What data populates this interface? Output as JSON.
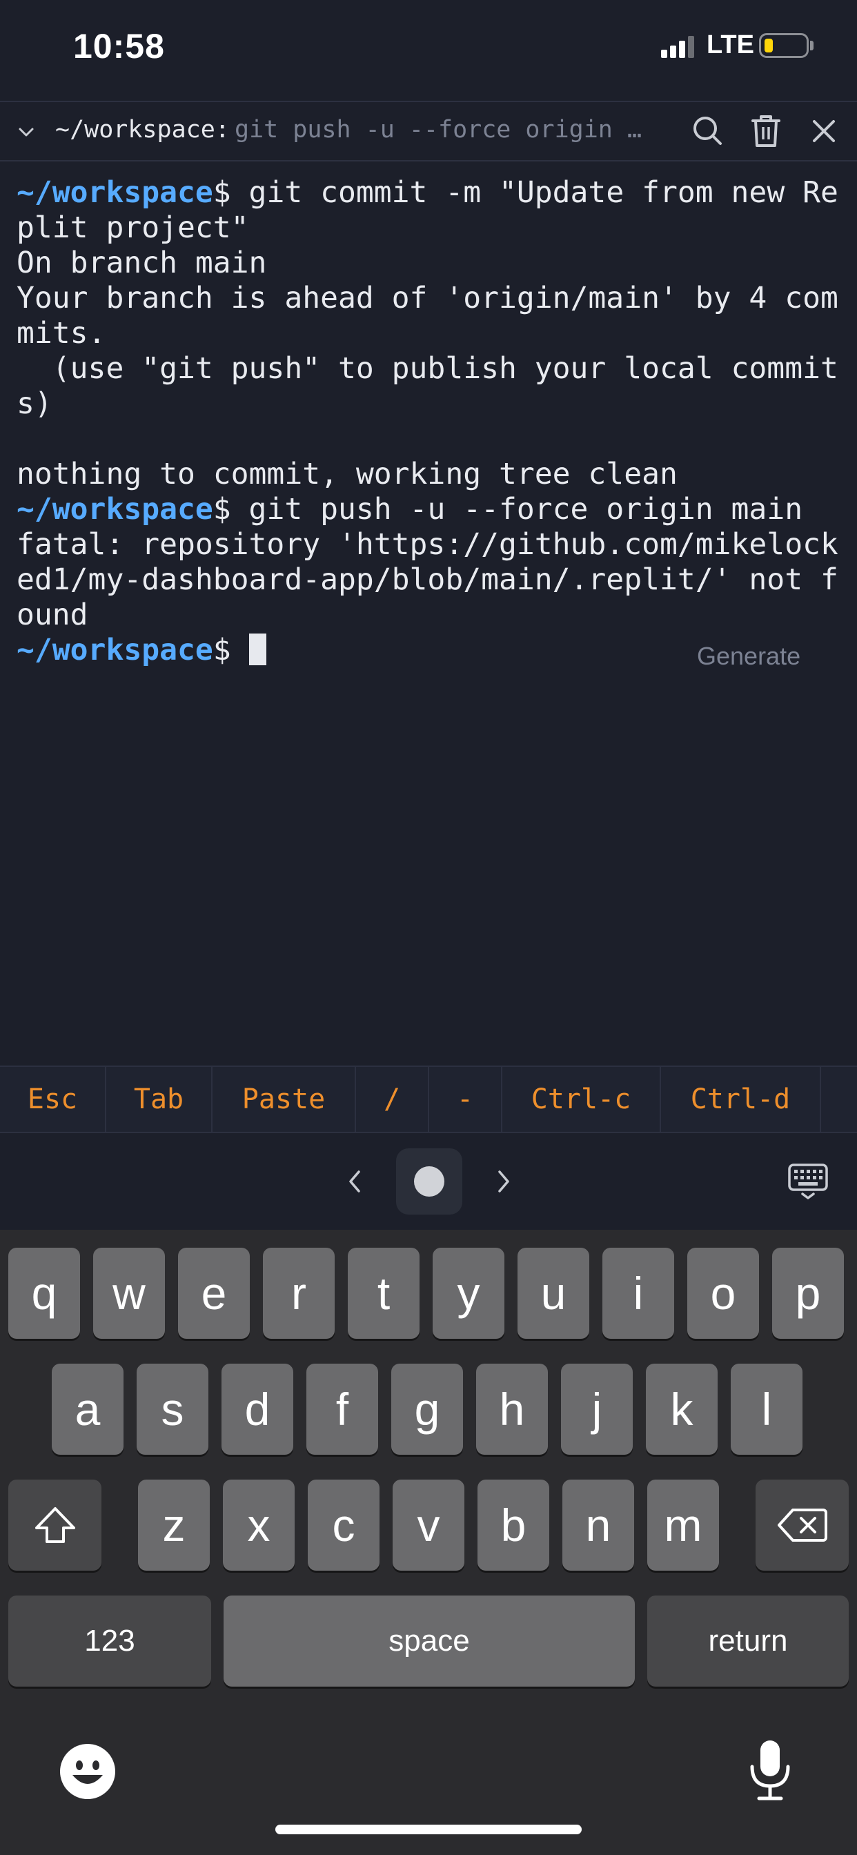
{
  "status_bar": {
    "time": "10:58",
    "network": "LTE",
    "battery_level": 0.2,
    "colors": {
      "battery": "#ffd60a"
    }
  },
  "terminal_tab": {
    "title": "~/workspace:",
    "command": "git push -u --force origin …",
    "icons": [
      "chevron-down-icon",
      "search-icon",
      "trash-icon",
      "close-icon"
    ]
  },
  "terminal": {
    "lines": [
      {
        "prompt": "~/workspace",
        "text": "$ git commit -m \"Update from new Re"
      },
      {
        "prompt": "",
        "text": "plit project\""
      },
      {
        "prompt": "",
        "text": "On branch main"
      },
      {
        "prompt": "",
        "text": "Your branch is ahead of 'origin/main' by 4 com"
      },
      {
        "prompt": "",
        "text": "mits."
      },
      {
        "prompt": "",
        "text": "  (use \"git push\" to publish your local commit"
      },
      {
        "prompt": "",
        "text": "s)"
      },
      {
        "prompt": "",
        "text": ""
      },
      {
        "prompt": "",
        "text": "nothing to commit, working tree clean"
      },
      {
        "prompt": "~/workspace",
        "text": "$ git push -u --force origin main"
      },
      {
        "prompt": "",
        "text": "fatal: repository 'https://github.com/mikelock"
      },
      {
        "prompt": "",
        "text": "ed1/my-dashboard-app/blob/main/.replit/' not f"
      },
      {
        "prompt": "",
        "text": "ound"
      },
      {
        "prompt": "~/workspace",
        "text": "$ ",
        "cursor": true
      }
    ],
    "generate_hint": "Generate",
    "colors": {
      "prompt": "#57abff",
      "text": "#e9ebf0"
    }
  },
  "extra_keys": {
    "keys": [
      "Esc",
      "Tab",
      "Paste",
      "/",
      "-",
      "Ctrl-c",
      "Ctrl-d"
    ],
    "color": "#ee8f2c"
  },
  "keyboard": {
    "row1": [
      "q",
      "w",
      "e",
      "r",
      "t",
      "y",
      "u",
      "i",
      "o",
      "p"
    ],
    "row2": [
      "a",
      "s",
      "d",
      "f",
      "g",
      "h",
      "j",
      "k",
      "l"
    ],
    "row3": [
      "z",
      "x",
      "c",
      "v",
      "b",
      "n",
      "m"
    ],
    "numbers_key": "123",
    "space_key": "space",
    "return_key": "return",
    "icons": [
      "shift-icon",
      "backspace-icon",
      "emoji-icon",
      "microphone-icon"
    ]
  }
}
